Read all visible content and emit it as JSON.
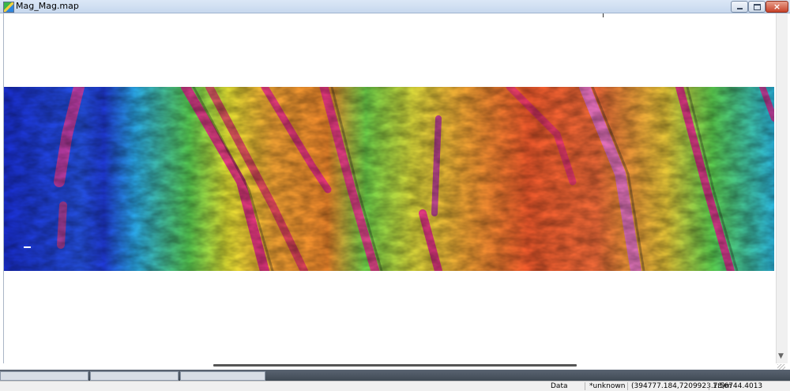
{
  "window": {
    "title": "Mag_Mag.map"
  },
  "title_buttons": {
    "minimize": "minimize-icon",
    "maximize": "maximize-icon",
    "close": "close-icon",
    "close_glyph": "×"
  },
  "map": {
    "colormap": [
      "#1a2fd6",
      "#28c8e6",
      "#39d24a",
      "#e8e634",
      "#f2a233",
      "#f25a2c",
      "#e0208c"
    ]
  },
  "status": {
    "mode": "Data",
    "projection": "*unknown",
    "coordinates": "(394777.184,7209923.78)m",
    "scale": "1:56744.4013"
  }
}
